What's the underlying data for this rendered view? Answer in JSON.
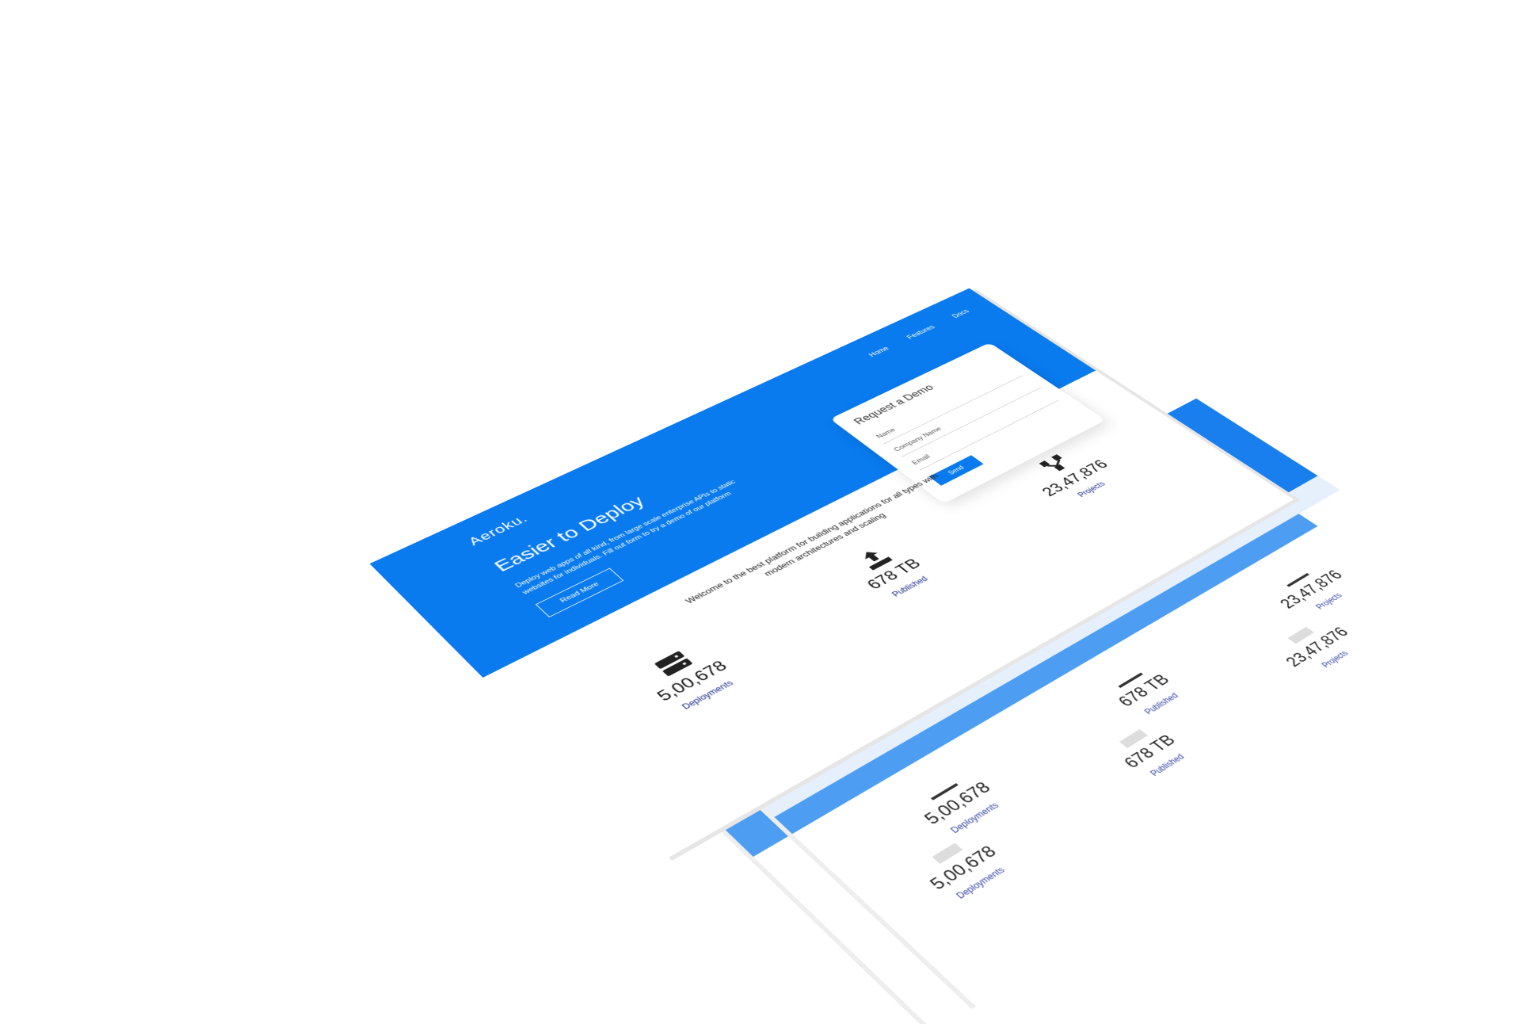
{
  "brand": "Aeroku.",
  "nav": {
    "items": [
      "Home",
      "Features",
      "Docs"
    ]
  },
  "hero": {
    "title": "Easier to Deploy",
    "description": "Deploy web apps of all kind, from large scale enterprise APIs to static websites for individuals. Fill out form to try a demo of our platform",
    "read_more_label": "Read More"
  },
  "demo_form": {
    "title": "Request a Demo",
    "name_placeholder": "Name",
    "company_placeholder": "Company Name",
    "email_placeholder": "Email",
    "send_label": "Send"
  },
  "welcome_text": "Welcome to the best platform for building applications for all types with modern architectures and scaling",
  "stats": [
    {
      "icon": "server-icon",
      "value": "5,00,678",
      "label": "Deployments"
    },
    {
      "icon": "upload-icon",
      "value": "678 TB",
      "label": "Published"
    },
    {
      "icon": "project-nodes-icon",
      "value": "23,47,876",
      "label": "Projects"
    }
  ],
  "ghost_text": "architectures and scaling",
  "colors": {
    "primary": "#097bef",
    "primary_light": "#4d9ef2",
    "label": "#1c2a8f"
  }
}
